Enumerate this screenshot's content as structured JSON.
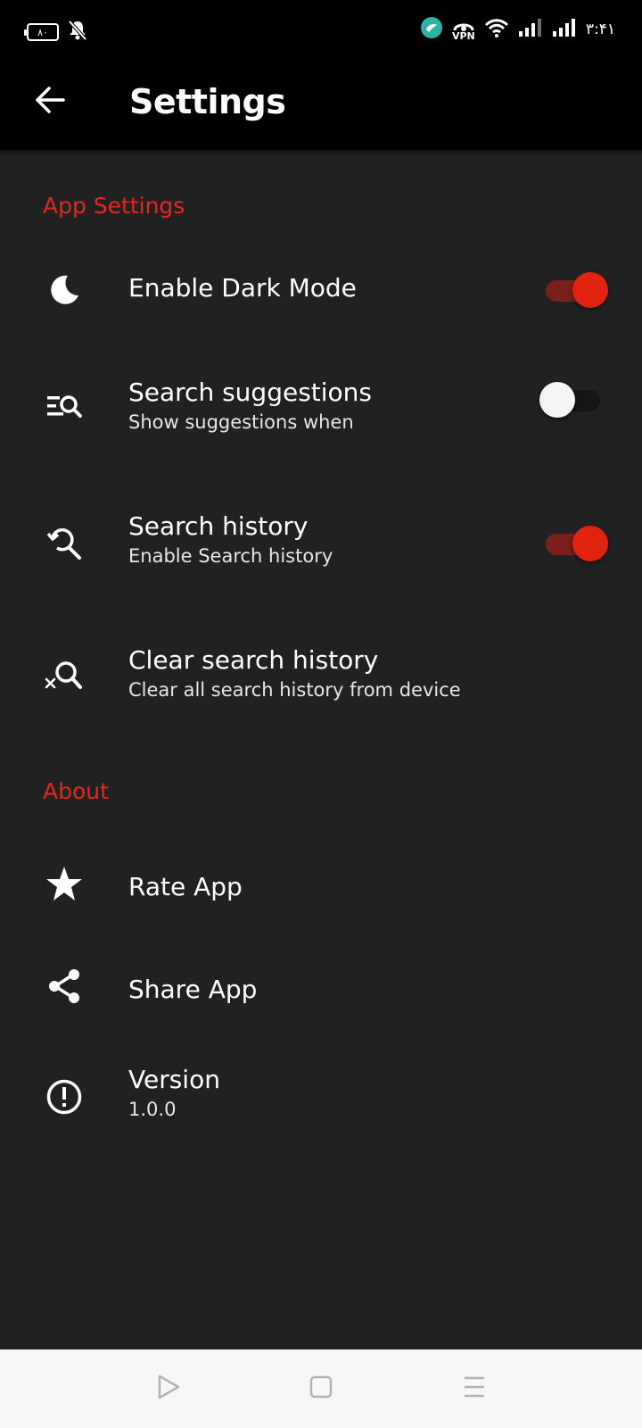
{
  "status_bar": {
    "battery_level": "۸۰",
    "vpn_label": "VPN",
    "time": "۳:۴۱"
  },
  "app_bar": {
    "title": "Settings",
    "back_icon": "arrow-back-icon"
  },
  "sections": {
    "app_settings": {
      "header": "App Settings",
      "items": {
        "dark_mode": {
          "icon": "moon-icon",
          "title": "Enable Dark Mode",
          "enabled": true
        },
        "search_suggestions": {
          "icon": "search-list-icon",
          "title": "Search suggestions",
          "subtitle": "Show suggestions when",
          "enabled": false
        },
        "search_history": {
          "icon": "search-history-icon",
          "title": "Search history",
          "subtitle": "Enable Search history",
          "enabled": true
        },
        "clear_history": {
          "icon": "search-clear-icon",
          "title": "Clear search history",
          "subtitle": "Clear all search history from device"
        }
      }
    },
    "about": {
      "header": "About",
      "items": {
        "rate": {
          "icon": "star-icon",
          "title": "Rate App"
        },
        "share": {
          "icon": "share-icon",
          "title": "Share App"
        },
        "version": {
          "icon": "info-icon",
          "title": "Version",
          "subtitle": "1.0.0"
        }
      }
    }
  },
  "colors": {
    "accent": "#e0281d",
    "background": "#212121",
    "app_bar": "#000000",
    "switch_on_thumb": "#e0230f",
    "switch_on_track": "#7a1f19"
  },
  "nav_bar": {
    "buttons": [
      "back-triangle-icon",
      "home-square-icon",
      "recents-menu-icon"
    ]
  }
}
